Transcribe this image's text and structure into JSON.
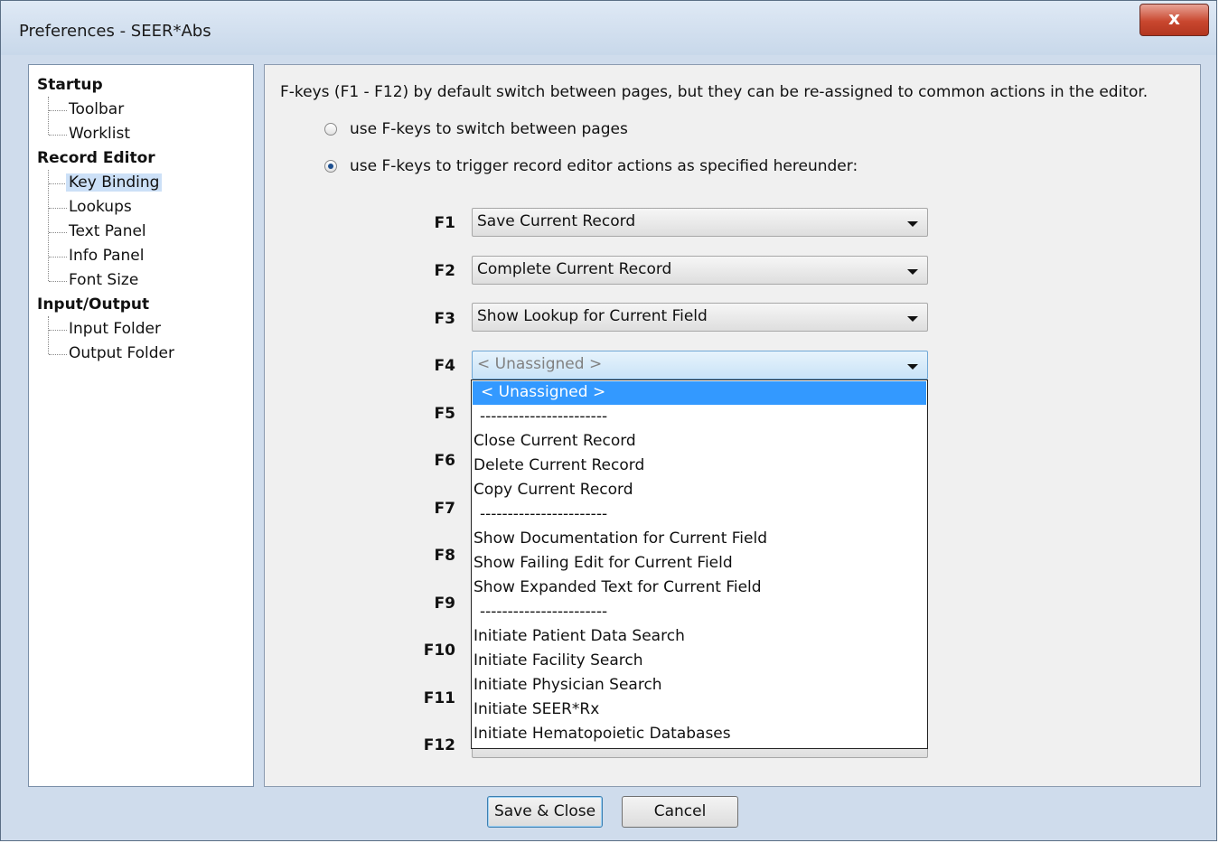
{
  "window": {
    "title": "Preferences - SEER*Abs",
    "close_glyph": "x"
  },
  "sidebar": {
    "categories": [
      {
        "label": "Startup",
        "items": [
          "Toolbar",
          "Worklist"
        ]
      },
      {
        "label": "Record Editor",
        "items": [
          "Key Binding",
          "Lookups",
          "Text Panel",
          "Info Panel",
          "Font Size"
        ]
      },
      {
        "label": "Input/Output",
        "items": [
          "Input Folder",
          "Output Folder"
        ]
      }
    ],
    "selected": "Key Binding"
  },
  "main": {
    "intro": "F-keys (F1 - F12) by default switch between pages, but they can be re-assigned to common actions in the editor.",
    "radio_pages": "use F-keys to switch between pages",
    "radio_actions": "use F-keys to trigger record editor actions as specified hereunder:",
    "selected_radio": "actions",
    "fkeys": [
      "F1",
      "F2",
      "F3",
      "F4",
      "F5",
      "F6",
      "F7",
      "F8",
      "F9",
      "F10",
      "F11",
      "F12"
    ],
    "bindings": {
      "F1": "Save Current Record",
      "F2": "Complete Current Record",
      "F3": "Show Lookup for Current Field",
      "F4": "< Unassigned >"
    }
  },
  "dropdown": {
    "selected": "< Unassigned >",
    "options": [
      "< Unassigned >",
      "-----------------------",
      "Close Current Record",
      "Delete Current Record",
      "Copy Current Record",
      "-----------------------",
      "Show Documentation for Current Field",
      "Show Failing Edit for Current Field",
      "Show Expanded Text for Current Field",
      "-----------------------",
      "Initiate Patient Data Search",
      "Initiate Facility Search",
      "Initiate Physician Search",
      "Initiate SEER*Rx",
      "Initiate Hematopoietic Databases"
    ]
  },
  "footer": {
    "save_label": "Save & Close",
    "cancel_label": "Cancel"
  }
}
